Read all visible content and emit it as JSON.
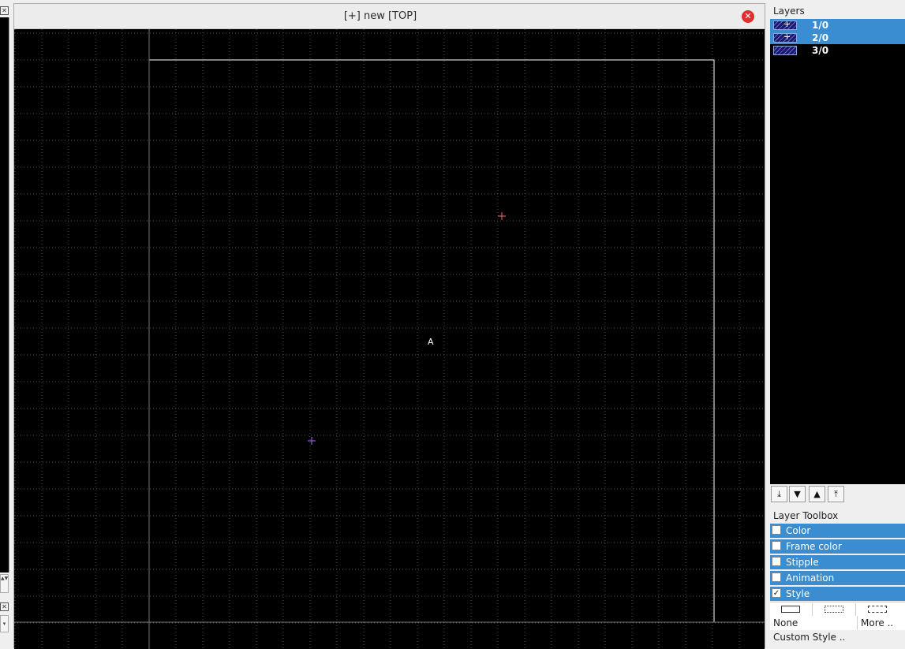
{
  "left_strip": {
    "close_top": "✕",
    "spin_arrows": "▲▼",
    "close_bottom": "✕",
    "dropdown_arrow": "▾"
  },
  "view": {
    "title": "[+] new [TOP]",
    "close_icon": "✕",
    "canvas_label": "A",
    "colors": {
      "background": "#000000",
      "grid": "#555555",
      "cell_frame": "#ffffff",
      "marker_red": "#ff6666",
      "marker_purple": "#b066ff"
    }
  },
  "layers": {
    "title": "Layers",
    "items": [
      {
        "name": "1/0",
        "selected": true,
        "icon": "crosshair-pattern"
      },
      {
        "name": "2/0",
        "selected": true,
        "icon": "crosshair-pattern"
      },
      {
        "name": "3/0",
        "selected": false,
        "icon": "hatch-pattern"
      }
    ],
    "buttons": [
      {
        "name": "move-to-bottom-button",
        "glyph": "⤓"
      },
      {
        "name": "move-down-button",
        "glyph": "▼"
      },
      {
        "name": "move-up-button",
        "glyph": "▲"
      },
      {
        "name": "move-to-top-button",
        "glyph": "⤒"
      }
    ]
  },
  "layer_toolbox": {
    "title": "Layer Toolbox",
    "sections": [
      {
        "label": "Color",
        "checked": false
      },
      {
        "label": "Frame color",
        "checked": false
      },
      {
        "label": "Stipple",
        "checked": false
      },
      {
        "label": "Animation",
        "checked": false
      },
      {
        "label": "Style",
        "checked": true
      }
    ],
    "style_none": "None",
    "style_more": "More ..",
    "custom_style": "Custom Style .."
  }
}
